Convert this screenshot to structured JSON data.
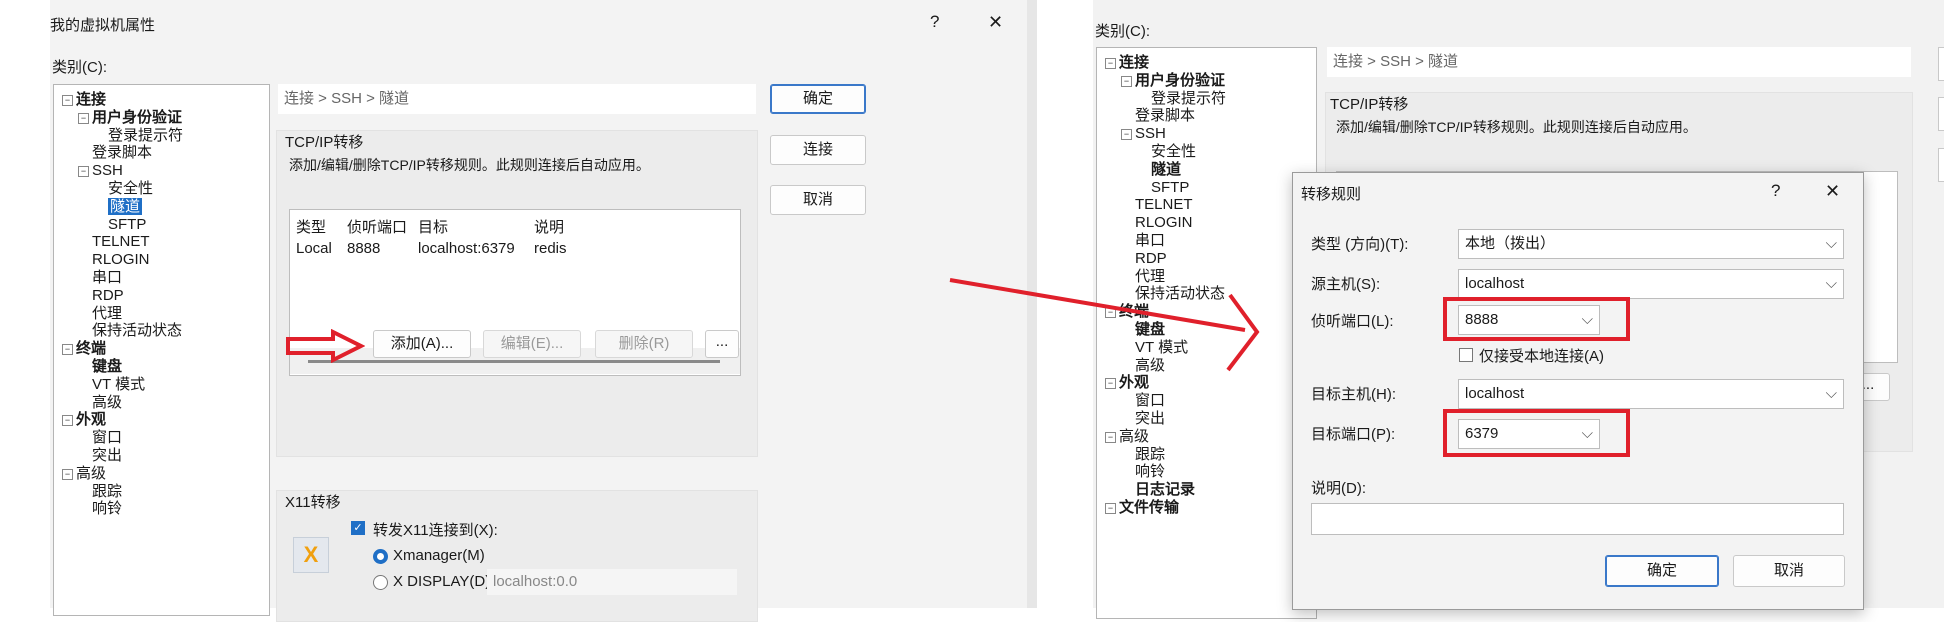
{
  "left_dialog": {
    "title": "我的虚拟机属性",
    "help_label": "?",
    "close_label": "✕",
    "category_label": "类别(C):",
    "tree": [
      {
        "label": "连接",
        "bold": true,
        "expander": "−"
      },
      {
        "label": "用户身份验证",
        "bold": true,
        "expander": "−"
      },
      {
        "label": "登录提示符"
      },
      {
        "label": "登录脚本"
      },
      {
        "label": "SSH",
        "expander": "−"
      },
      {
        "label": "安全性"
      },
      {
        "label": "隧道",
        "selected": true
      },
      {
        "label": "SFTP"
      },
      {
        "label": "TELNET"
      },
      {
        "label": "RLOGIN"
      },
      {
        "label": "串口"
      },
      {
        "label": "RDP"
      },
      {
        "label": "代理"
      },
      {
        "label": "保持活动状态"
      },
      {
        "label": "终端",
        "bold": true,
        "expander": "−"
      },
      {
        "label": "键盘",
        "bold": true
      },
      {
        "label": "VT 模式"
      },
      {
        "label": "高级"
      },
      {
        "label": "外观",
        "bold": true,
        "expander": "−"
      },
      {
        "label": "窗口"
      },
      {
        "label": "突出"
      },
      {
        "label": "高级",
        "expander": "−"
      },
      {
        "label": "跟踪"
      },
      {
        "label": "响铃"
      }
    ],
    "breadcrumb": "连接 > SSH > 隧道",
    "tcp_section_title": "TCP/IP转移",
    "tcp_description": "添加/编辑/删除TCP/IP转移规则。此规则连接后自动应用。",
    "table_headers": [
      "类型",
      "侦听端口",
      "目标",
      "说明"
    ],
    "table_rows": [
      [
        "Local",
        "8888",
        "localhost:6379",
        "redis"
      ]
    ],
    "add_button": "添加(A)...",
    "edit_button": "编辑(E)...",
    "delete_button": "删除(R)",
    "more_button": "...",
    "ok_button": "确定",
    "connect_button": "连接",
    "cancel_button": "取消",
    "x11_title": "X11转移",
    "x11_checkbox": "转发X11连接到(X):",
    "xmanager_option": "Xmanager(M)",
    "xdisplay_option": "X DISPLAY(D):",
    "xdisplay_value": "localhost:0.0"
  },
  "right_dialog": {
    "category_label": "类别(C):",
    "tree": [
      {
        "label": "连接",
        "bold": true,
        "expander": "−"
      },
      {
        "label": "用户身份验证",
        "bold": true,
        "expander": "−"
      },
      {
        "label": "登录提示符"
      },
      {
        "label": "登录脚本"
      },
      {
        "label": "SSH",
        "expander": "−"
      },
      {
        "label": "安全性"
      },
      {
        "label": "隧道",
        "bold": true
      },
      {
        "label": "SFTP"
      },
      {
        "label": "TELNET"
      },
      {
        "label": "RLOGIN"
      },
      {
        "label": "串口"
      },
      {
        "label": "RDP"
      },
      {
        "label": "代理"
      },
      {
        "label": "保持活动状态"
      },
      {
        "label": "终端",
        "bold": true,
        "expander": "−"
      },
      {
        "label": "键盘",
        "bold": true
      },
      {
        "label": "VT 模式"
      },
      {
        "label": "高级"
      },
      {
        "label": "外观",
        "bold": true,
        "expander": "−"
      },
      {
        "label": "窗口"
      },
      {
        "label": "突出"
      },
      {
        "label": "高级",
        "expander": "−"
      },
      {
        "label": "跟踪"
      },
      {
        "label": "响铃"
      },
      {
        "label": "日志记录",
        "bold": true
      },
      {
        "label": "文件传输",
        "bold": true,
        "expander": "−"
      }
    ],
    "breadcrumb": "连接 > SSH > 隧道",
    "tcp_section_title": "TCP/IP转移",
    "tcp_description": "添加/编辑/删除TCP/IP转移规则。此规则连接后自动应用。",
    "more_button": "..."
  },
  "rule_dialog": {
    "title": "转移规则",
    "help_label": "?",
    "close_label": "✕",
    "type_label": "类型 (方向)(T):",
    "type_value": "本地（拨出）",
    "source_label": "源主机(S):",
    "source_value": "localhost",
    "listen_label": "侦听端口(L):",
    "listen_value": "8888",
    "local_only_label": "仅接受本地连接(A)",
    "target_host_label": "目标主机(H):",
    "target_host_value": "localhost",
    "target_port_label": "目标端口(P):",
    "target_port_value": "6379",
    "desc_label": "说明(D):",
    "desc_value": "",
    "ok_button": "确定",
    "cancel_button": "取消"
  },
  "colors": {
    "highlight": "#e0202b",
    "accent": "#1f6fc6",
    "selected_bg": "#1f6fc6"
  }
}
